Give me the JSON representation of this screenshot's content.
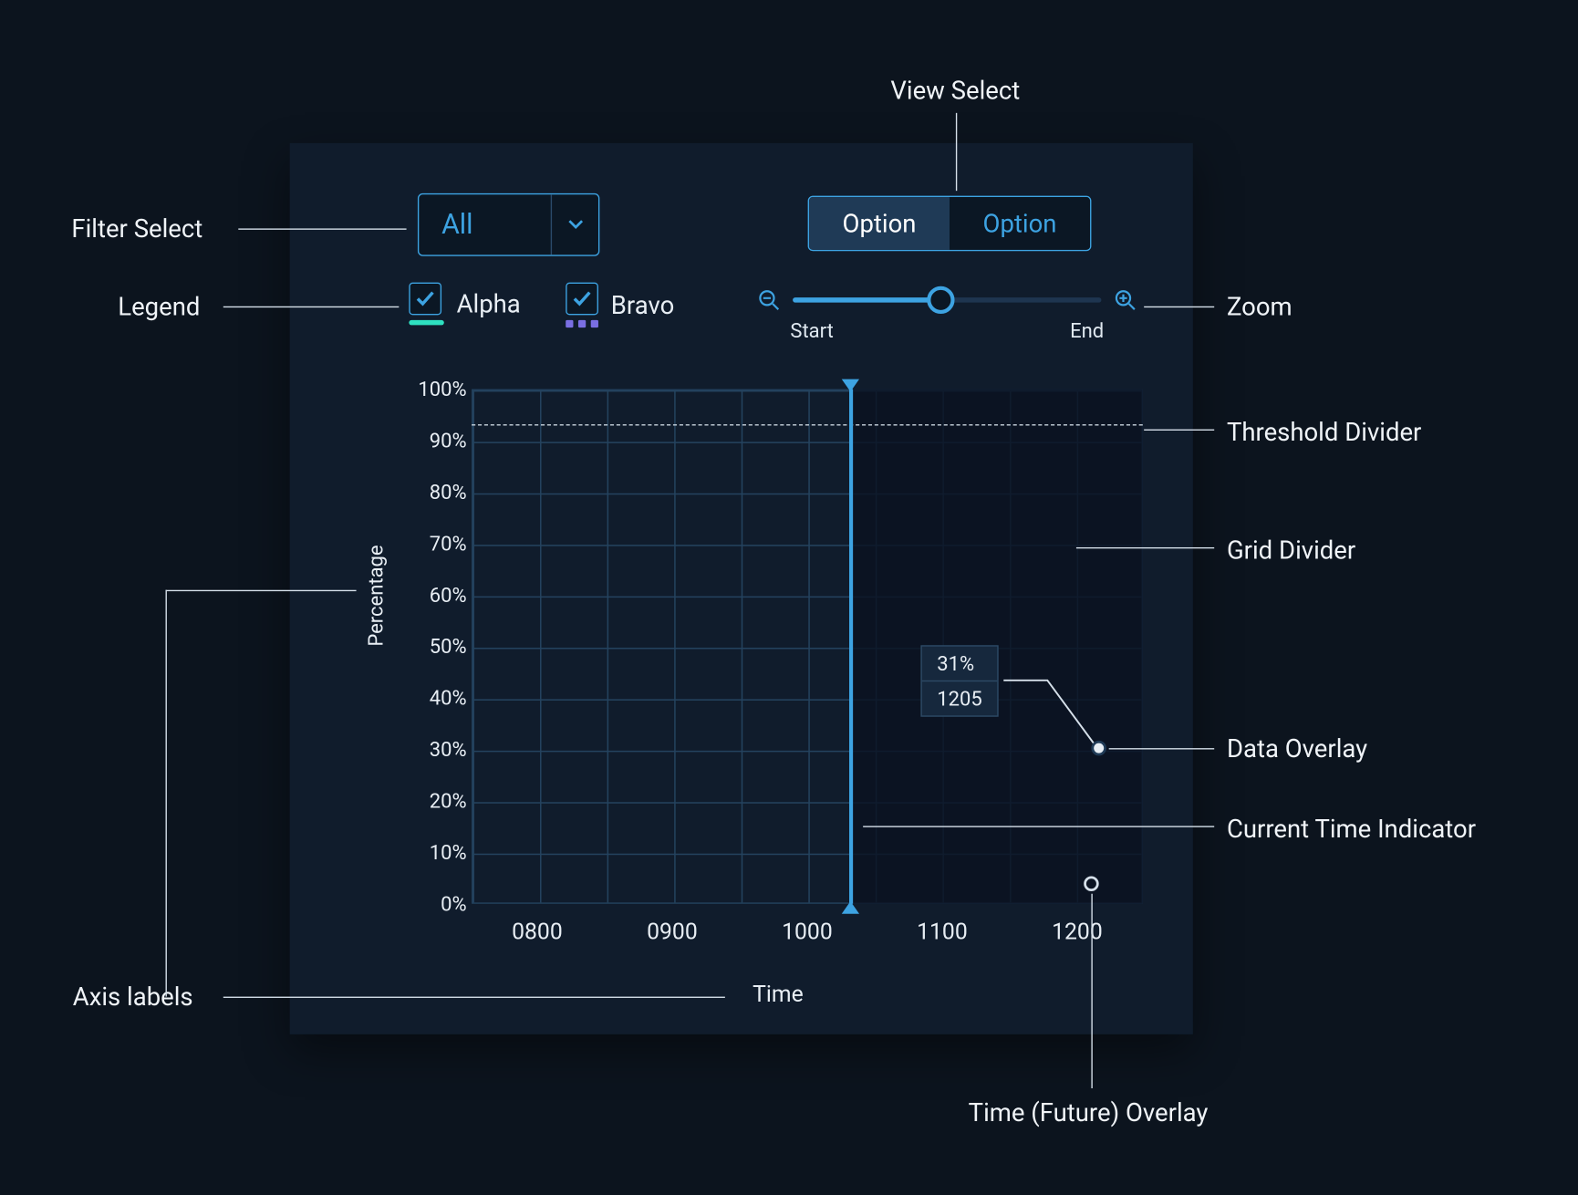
{
  "filter": {
    "value": "All"
  },
  "view_select": {
    "options": [
      "Option",
      "Option"
    ],
    "active_index": 0
  },
  "legend": {
    "items": [
      {
        "label": "Alpha",
        "checked": true,
        "style": "line",
        "color": "#2ee0c0"
      },
      {
        "label": "Bravo",
        "checked": true,
        "style": "dots",
        "color": "#7a6fe3"
      }
    ]
  },
  "zoom": {
    "start_label": "Start",
    "end_label": "End",
    "position": 0.48
  },
  "chart_data": {
    "type": "line",
    "title": "",
    "xlabel": "Time",
    "ylabel": "Percentage",
    "ylim": [
      0,
      100
    ],
    "y_ticks": [
      "0%",
      "10%",
      "20%",
      "30%",
      "40%",
      "50%",
      "60%",
      "70%",
      "80%",
      "90%",
      "100%"
    ],
    "x_ticks": [
      "0800",
      "0900",
      "1000",
      "1100",
      "1200"
    ],
    "threshold_pct": 93,
    "current_time_x": "1030",
    "series": [
      {
        "name": "Alpha",
        "values": []
      },
      {
        "name": "Bravo",
        "values": []
      }
    ],
    "data_point_overlay": {
      "value_pct": "31%",
      "time": "1205",
      "y": 31,
      "x": "1205"
    }
  },
  "annotations": {
    "filter_select": "Filter Select",
    "legend": "Legend",
    "axis_labels": "Axis labels",
    "view_select": "View Select",
    "zoom": "Zoom",
    "threshold": "Threshold Divider",
    "grid": "Grid Divider",
    "data_overlay": "Data Overlay",
    "current_time": "Current Time Indicator",
    "future_overlay": "Time (Future) Overlay"
  }
}
